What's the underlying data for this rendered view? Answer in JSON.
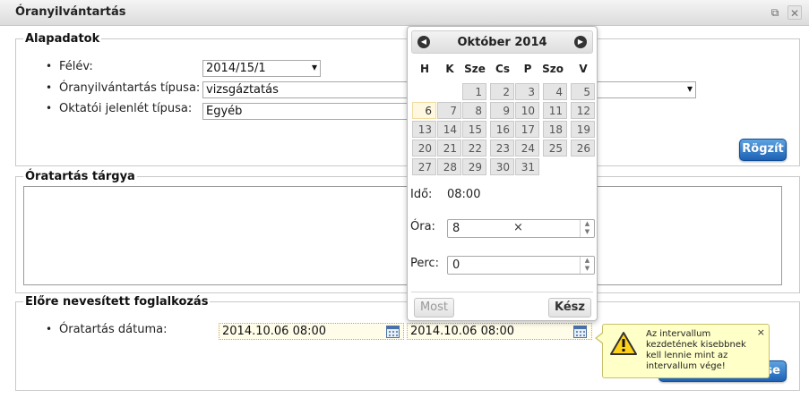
{
  "window": {
    "title": "Óranyilvántartás",
    "popout_icon": "⧉",
    "close_icon": "✕"
  },
  "alapadatok": {
    "legend": "Alapadatok",
    "felev_label": "Félév:",
    "felev_value": "2014/15/1",
    "tipus_label": "Óranyilvántartás típusa:",
    "tipus_value": "vizsgáztatás",
    "jelenlet_label": "Oktatói jelenlét típusa:",
    "jelenlet_value": "Egyéb",
    "save_label": "Rögzít"
  },
  "targy": {
    "legend": "Óratartás tárgya"
  },
  "foglalkozas": {
    "legend": "Előre nevesített foglalkozás",
    "datum_label": "Óratartás dátuma:",
    "datum_from": "2014.10.06 08:00",
    "datum_to": "2014.10.06 08:00",
    "hidden_button_tail": "se"
  },
  "datepicker": {
    "month_title": "Október 2014",
    "prev_icon": "◀",
    "next_icon": "▶",
    "weekdays": [
      "H",
      "K",
      "Sze",
      "Cs",
      "P",
      "Szo",
      "V"
    ],
    "days": [
      "1",
      "2",
      "3",
      "4",
      "5",
      "6",
      "7",
      "8",
      "9",
      "10",
      "11",
      "12",
      "13",
      "14",
      "15",
      "16",
      "17",
      "18",
      "19",
      "20",
      "21",
      "22",
      "23",
      "24",
      "25",
      "26",
      "27",
      "28",
      "29",
      "30",
      "31"
    ],
    "selected_day": "6",
    "ido_label": "Idő:",
    "ido_value": "08:00",
    "ora_label": "Óra:",
    "ora_value": "8",
    "ora_clear": "×",
    "perc_label": "Perc:",
    "perc_value": "0",
    "now_label": "Most",
    "done_label": "Kész"
  },
  "warning": {
    "text": "Az intervallum kezdetének kisebbnek kell lennie mint az intervallum vége!",
    "close": "×"
  },
  "colors": {
    "accent": "#1d62b5",
    "tooltip": "#ffffc8",
    "date_field": "#fffde9"
  }
}
